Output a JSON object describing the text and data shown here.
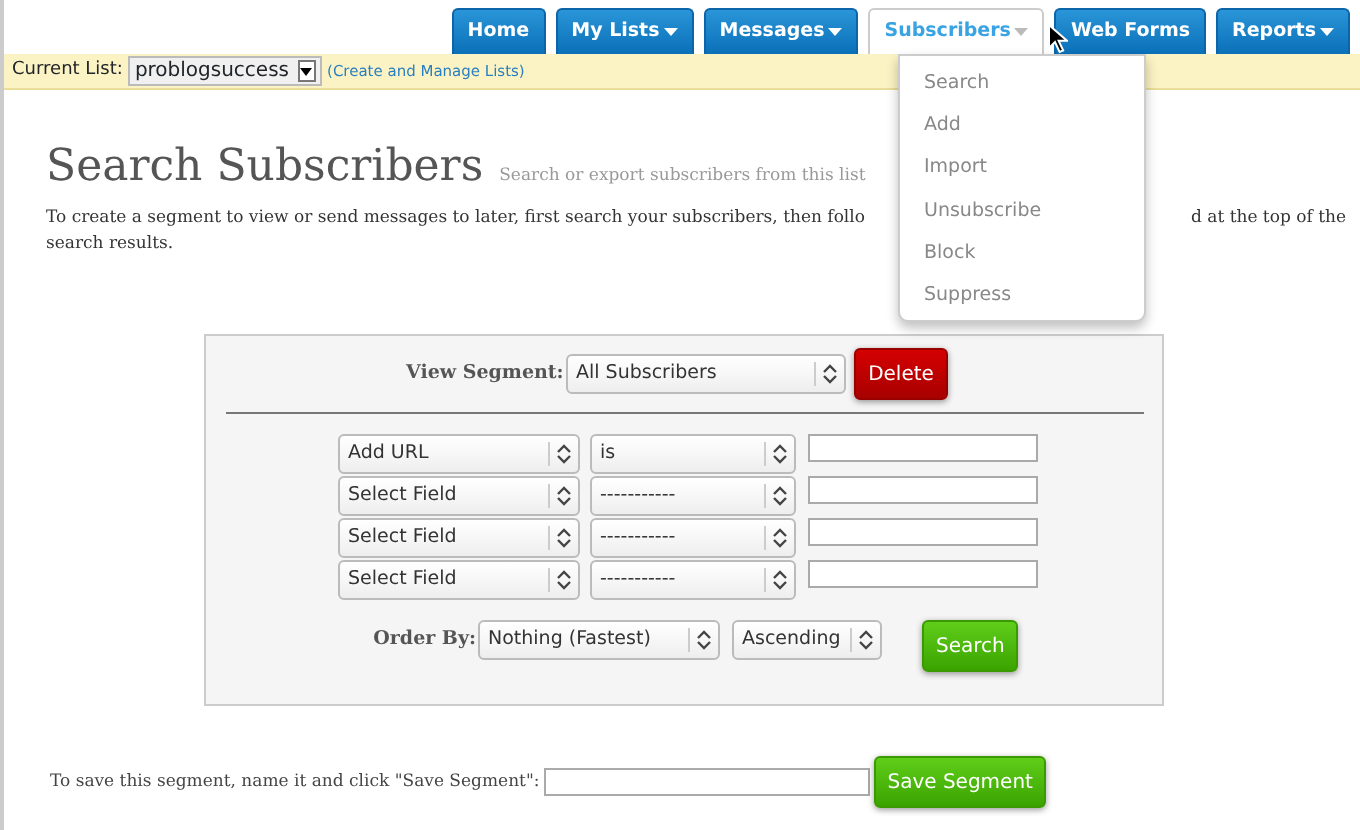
{
  "nav": {
    "tabs": [
      {
        "label": "Home",
        "has_caret": false,
        "selected": false
      },
      {
        "label": "My Lists",
        "has_caret": true,
        "selected": false
      },
      {
        "label": "Messages",
        "has_caret": true,
        "selected": false
      },
      {
        "label": "Subscribers",
        "has_caret": true,
        "selected": true
      },
      {
        "label": "Web Forms",
        "has_caret": false,
        "selected": false
      },
      {
        "label": "Reports",
        "has_caret": true,
        "selected": false
      }
    ]
  },
  "list_bar": {
    "label": "Current List:",
    "list": "problogsuccess",
    "link": "(Create and Manage Lists)"
  },
  "menu": {
    "items": [
      "Search",
      "Add",
      "Import",
      "Unsubscribe",
      "Block",
      "Suppress"
    ]
  },
  "page": {
    "title": "Search Subscribers",
    "subtitle": "Search or export subscribers from this list",
    "intro_left": "To create a segment to view or send messages to later, first search your subscribers, then follo",
    "intro_right": "d at the top of the",
    "intro_line2": "search results."
  },
  "search_panel": {
    "view_label": "View Segment:",
    "segment": "All Subscribers",
    "delete": "Delete",
    "criteria": [
      {
        "field": "Add URL",
        "operator": "is"
      },
      {
        "field": "Select Field",
        "operator": "-----------"
      },
      {
        "field": "Select Field",
        "operator": "-----------"
      },
      {
        "field": "Select Field",
        "operator": "-----------"
      }
    ],
    "order_label": "Order By:",
    "order_by": "Nothing (Fastest)",
    "direction": "Ascending",
    "search": "Search"
  },
  "save": {
    "prompt": "To save this segment, name it and click \"Save Segment\":",
    "button": "Save Segment"
  }
}
